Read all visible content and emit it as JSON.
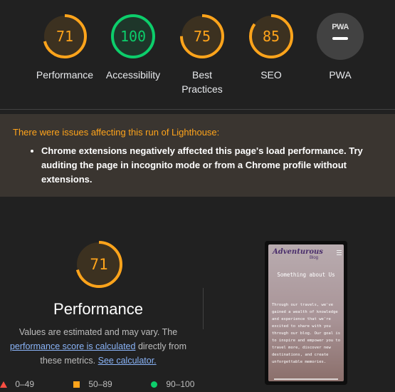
{
  "categories": [
    {
      "score": "71",
      "label": "Performance",
      "score_value": 71,
      "color": "#ffa41b"
    },
    {
      "score": "100",
      "label": "Accessibility",
      "score_value": 100,
      "color": "#0cce6b"
    },
    {
      "score": "75",
      "label": "Best Practices",
      "score_value": 75,
      "color": "#ffa41b"
    },
    {
      "score": "85",
      "label": "SEO",
      "score_value": 85,
      "color": "#ffa41b"
    }
  ],
  "pwa": {
    "badge_text": "PWA",
    "label": "PWA",
    "icon": "pwa-badge-icon"
  },
  "warning": {
    "title": "There were issues affecting this run of Lighthouse:",
    "items": [
      "Chrome extensions negatively affected this page's load performance. Try auditing the page in incognito mode or from a Chrome profile without extensions."
    ]
  },
  "performance": {
    "score": "71",
    "score_value": 71,
    "title": "Performance",
    "desc_1": "Values are estimated and may vary. The",
    "link_1": "performance score is calculated",
    "desc_2": "directly from these metrics.",
    "link_2": "See calculator."
  },
  "legend": [
    {
      "range": "0–49",
      "icon": "triangle-fail-icon",
      "color": "#ff4e42"
    },
    {
      "range": "50–89",
      "icon": "square-average-icon",
      "color": "#ffa41b"
    },
    {
      "range": "90–100",
      "icon": "circle-pass-icon",
      "color": "#0cce6b"
    }
  ],
  "screenshot": {
    "logo": "Adventurous",
    "logo_sub": "Blog",
    "heading": "Something about Us",
    "body": "Through our travels, we've gained a wealth of knowledge and experience that we're excited to share with you through our blog. Our goal is to inspire and empower you to travel more, discover new destinations, and create unforgettable memories."
  },
  "colors": {
    "pass": "#0cce6b",
    "average": "#ffa41b",
    "fail": "#ff4e42",
    "link": "#8ab4f8"
  }
}
